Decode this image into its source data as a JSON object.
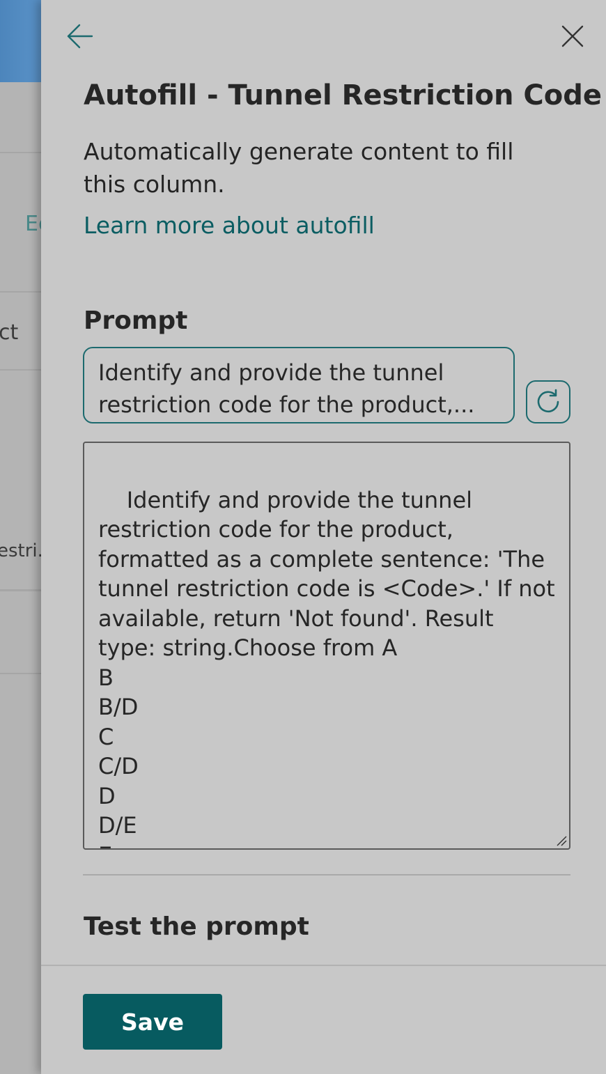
{
  "background": {
    "fragments": [
      "Ec",
      "ct",
      "estri.."
    ]
  },
  "panel": {
    "title": "Autofill - Tunnel Restriction Code",
    "subtitle": "Automatically generate content to fill this column.",
    "learn_more": "Learn more about autofill",
    "prompt_label": "Prompt",
    "prompt_summary": "Identify and provide the tunnel restriction code for the product,...",
    "prompt_text": "Identify and provide the tunnel restriction code for the product, formatted as a complete sentence: 'The tunnel restriction code is <Code>.' If not available, return 'Not found'. Result type: string.Choose from A\nB\nB/D\nC\nC/D\nD\nD/E\nE",
    "test_label": "Test the prompt",
    "save_label": "Save"
  },
  "icons": {
    "back": "arrow-left-icon",
    "close": "close-icon",
    "refresh": "refresh-icon",
    "resize": "resize-grip-icon"
  },
  "colors": {
    "accent": "#075b60",
    "link": "#0b5d62",
    "border": "#1c6a6e"
  }
}
